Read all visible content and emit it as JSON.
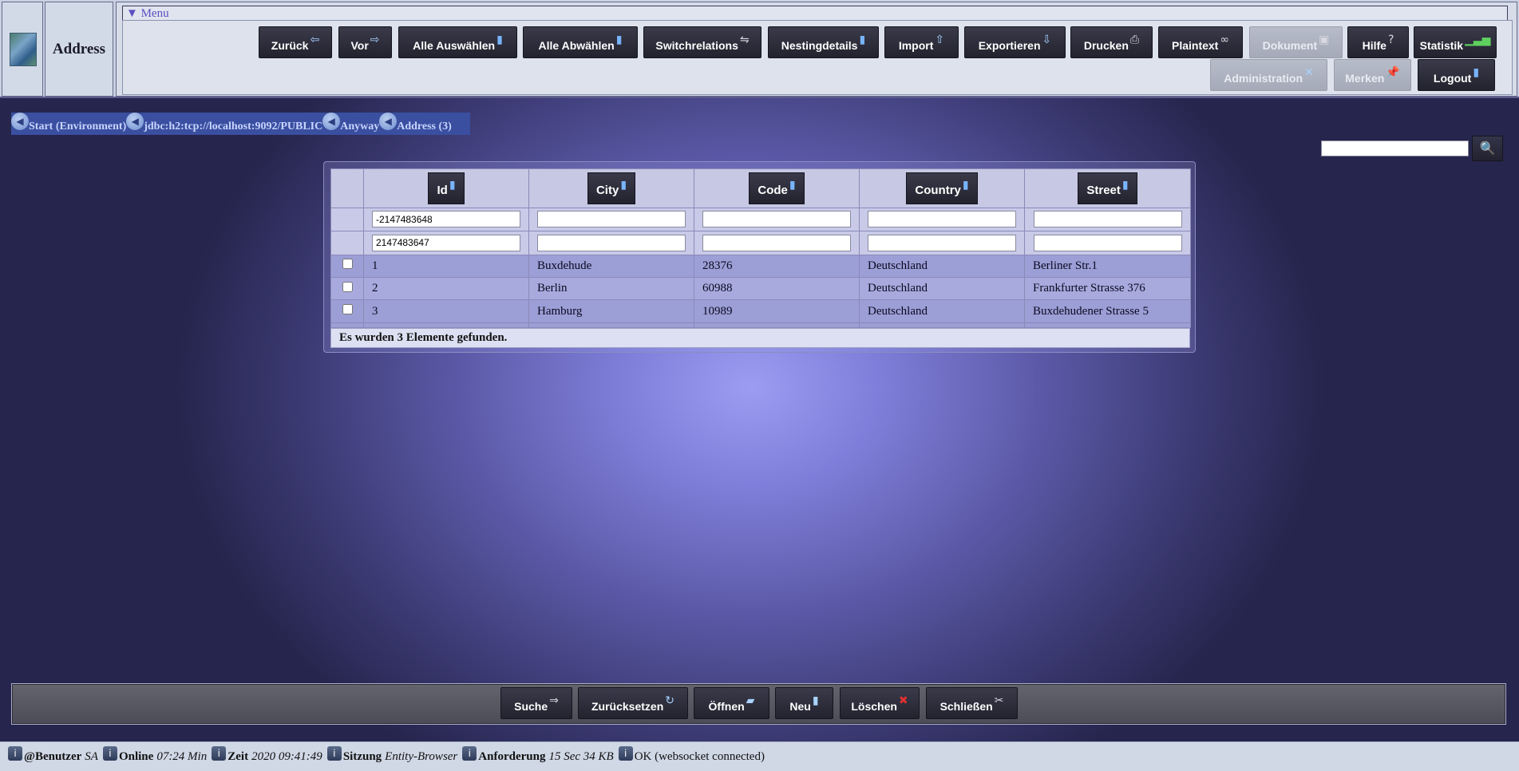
{
  "app": {
    "title": "Address"
  },
  "menu": {
    "toggle_label": "▼ Menu"
  },
  "toolbar": {
    "zurueck": {
      "label": "Zurück",
      "icon": "arrow-left-icon",
      "glyph": "⇦"
    },
    "vor": {
      "label": "Vor",
      "icon": "arrow-right-icon",
      "glyph": "⇨"
    },
    "alle_auswaehlen": {
      "label": "Alle Auswählen",
      "icon": "document-icon",
      "glyph": "▮"
    },
    "alle_abwaehlen": {
      "label": "Alle Abwählen",
      "icon": "document-icon",
      "glyph": "▮"
    },
    "switchrelations": {
      "label": "Switchrelations",
      "icon": "switch-icon",
      "glyph": "⇋"
    },
    "nestingdetails": {
      "label": "Nestingdetails",
      "icon": "document-icon",
      "glyph": "▮"
    },
    "import": {
      "label": "Import",
      "icon": "upload-icon",
      "glyph": "⇧"
    },
    "exportieren": {
      "label": "Exportieren",
      "icon": "download-icon",
      "glyph": "⇩"
    },
    "drucken": {
      "label": "Drucken",
      "icon": "printer-icon",
      "glyph": "⎙"
    },
    "plaintext": {
      "label": "Plaintext",
      "icon": "glasses-icon",
      "glyph": "∞"
    },
    "dokument": {
      "label": "Dokument",
      "icon": "image-icon",
      "glyph": "▣"
    },
    "hilfe": {
      "label": "Hilfe",
      "icon": "help-icon",
      "glyph": "?"
    },
    "statistik": {
      "label": "Statistik",
      "icon": "bar-chart-icon",
      "glyph": "▁▃▅"
    },
    "administration": {
      "label": "Administration",
      "icon": "tools-icon",
      "glyph": "✕"
    },
    "merken": {
      "label": "Merken",
      "icon": "pin-icon",
      "glyph": "📌"
    },
    "logout": {
      "label": "Logout",
      "icon": "logout-icon",
      "glyph": "▮"
    }
  },
  "breadcrumb": [
    {
      "label": "Start (Environment)"
    },
    {
      "label": "jdbc:h2:tcp://localhost:9092/PUBLIC"
    },
    {
      "label": "Anyway"
    },
    {
      "label": "Address (3)"
    }
  ],
  "search": {
    "value": "",
    "icon": "search-icon"
  },
  "table": {
    "columns": [
      {
        "label": "Id"
      },
      {
        "label": "City"
      },
      {
        "label": "Code"
      },
      {
        "label": "Country"
      },
      {
        "label": "Street"
      }
    ],
    "filter_from": [
      "-2147483648",
      "",
      "",
      "",
      ""
    ],
    "filter_to": [
      "2147483647",
      "",
      "",
      "",
      ""
    ],
    "rows": [
      [
        "1",
        "Buxdehude",
        "28376",
        "Deutschland",
        "Berliner Str.1"
      ],
      [
        "2",
        "Berlin",
        "60988",
        "Deutschland",
        "Frankfurter Strasse 376"
      ],
      [
        "3",
        "Hamburg",
        "10989",
        "Deutschland",
        "Buxdehudener Strasse 5"
      ]
    ],
    "summary": "Es wurden 3 Elemente gefunden."
  },
  "actions": {
    "suche": {
      "label": "Suche",
      "icon": "search-arrow-icon",
      "glyph": "⇒"
    },
    "zuruecksetzen": {
      "label": "Zurücksetzen",
      "icon": "reset-icon",
      "glyph": "↻"
    },
    "oeffnen": {
      "label": "Öffnen",
      "icon": "folder-open-icon",
      "glyph": "▰"
    },
    "neu": {
      "label": "Neu",
      "icon": "new-document-icon",
      "glyph": "▮"
    },
    "loeschen": {
      "label": "Löschen",
      "icon": "delete-icon",
      "glyph": "✖"
    },
    "schliessen": {
      "label": "Schließen",
      "icon": "close-icon",
      "glyph": "✂"
    }
  },
  "status": {
    "benutzer": {
      "key": "@Benutzer",
      "value": "SA"
    },
    "online": {
      "key": "Online",
      "value": "07:24 Min"
    },
    "zeit": {
      "key": "Zeit",
      "value": "2020 09:41:49"
    },
    "sitzung": {
      "key": "Sitzung",
      "value": "Entity-Browser"
    },
    "anforderung": {
      "key": "Anforderung",
      "value": "15 Sec 34 KB"
    },
    "connection": {
      "value": "OK (websocket connected)"
    }
  }
}
